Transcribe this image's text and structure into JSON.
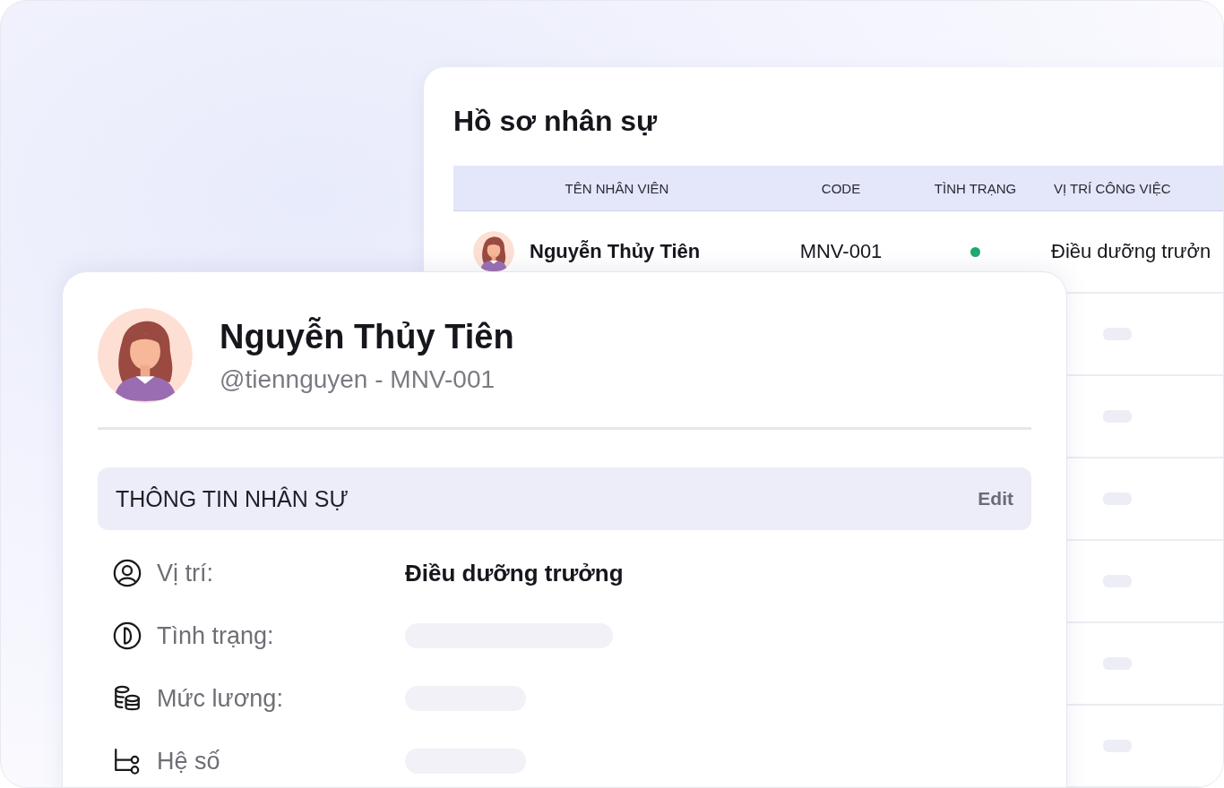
{
  "table_panel": {
    "title": "Hồ sơ nhân sự",
    "columns": [
      "TÊN NHÂN VIÊN",
      "CODE",
      "TÌNH TRẠNG",
      "VỊ TRÍ CÔNG VIỆC"
    ],
    "rows": [
      {
        "kind": "employee",
        "name": "Nguyễn Thủy Tiên",
        "code": "MNV-001",
        "color": "#1fa971",
        "position": "Điều dưỡng trưởn"
      },
      {
        "kind": "skeleton"
      },
      {
        "kind": "skeleton"
      },
      {
        "kind": "skeleton"
      },
      {
        "kind": "skeleton"
      },
      {
        "kind": "skeleton"
      },
      {
        "kind": "skeleton"
      }
    ]
  },
  "profile_card": {
    "name": "Nguyễn Thủy Tiên",
    "handle": "@tiennguyen - MNV-001",
    "section": {
      "title": "THÔNG TIN NHÂN SỰ",
      "action": "Edit"
    },
    "fields": [
      {
        "label": "Vị trí:",
        "kind": "text",
        "value": "Điều dưỡng trưởng"
      },
      {
        "label": "Tình trạng:",
        "kind": "skeleton"
      },
      {
        "label": "Mức lương:",
        "kind": "skeleton"
      },
      {
        "label": "Hệ số",
        "kind": "skeleton"
      }
    ]
  }
}
